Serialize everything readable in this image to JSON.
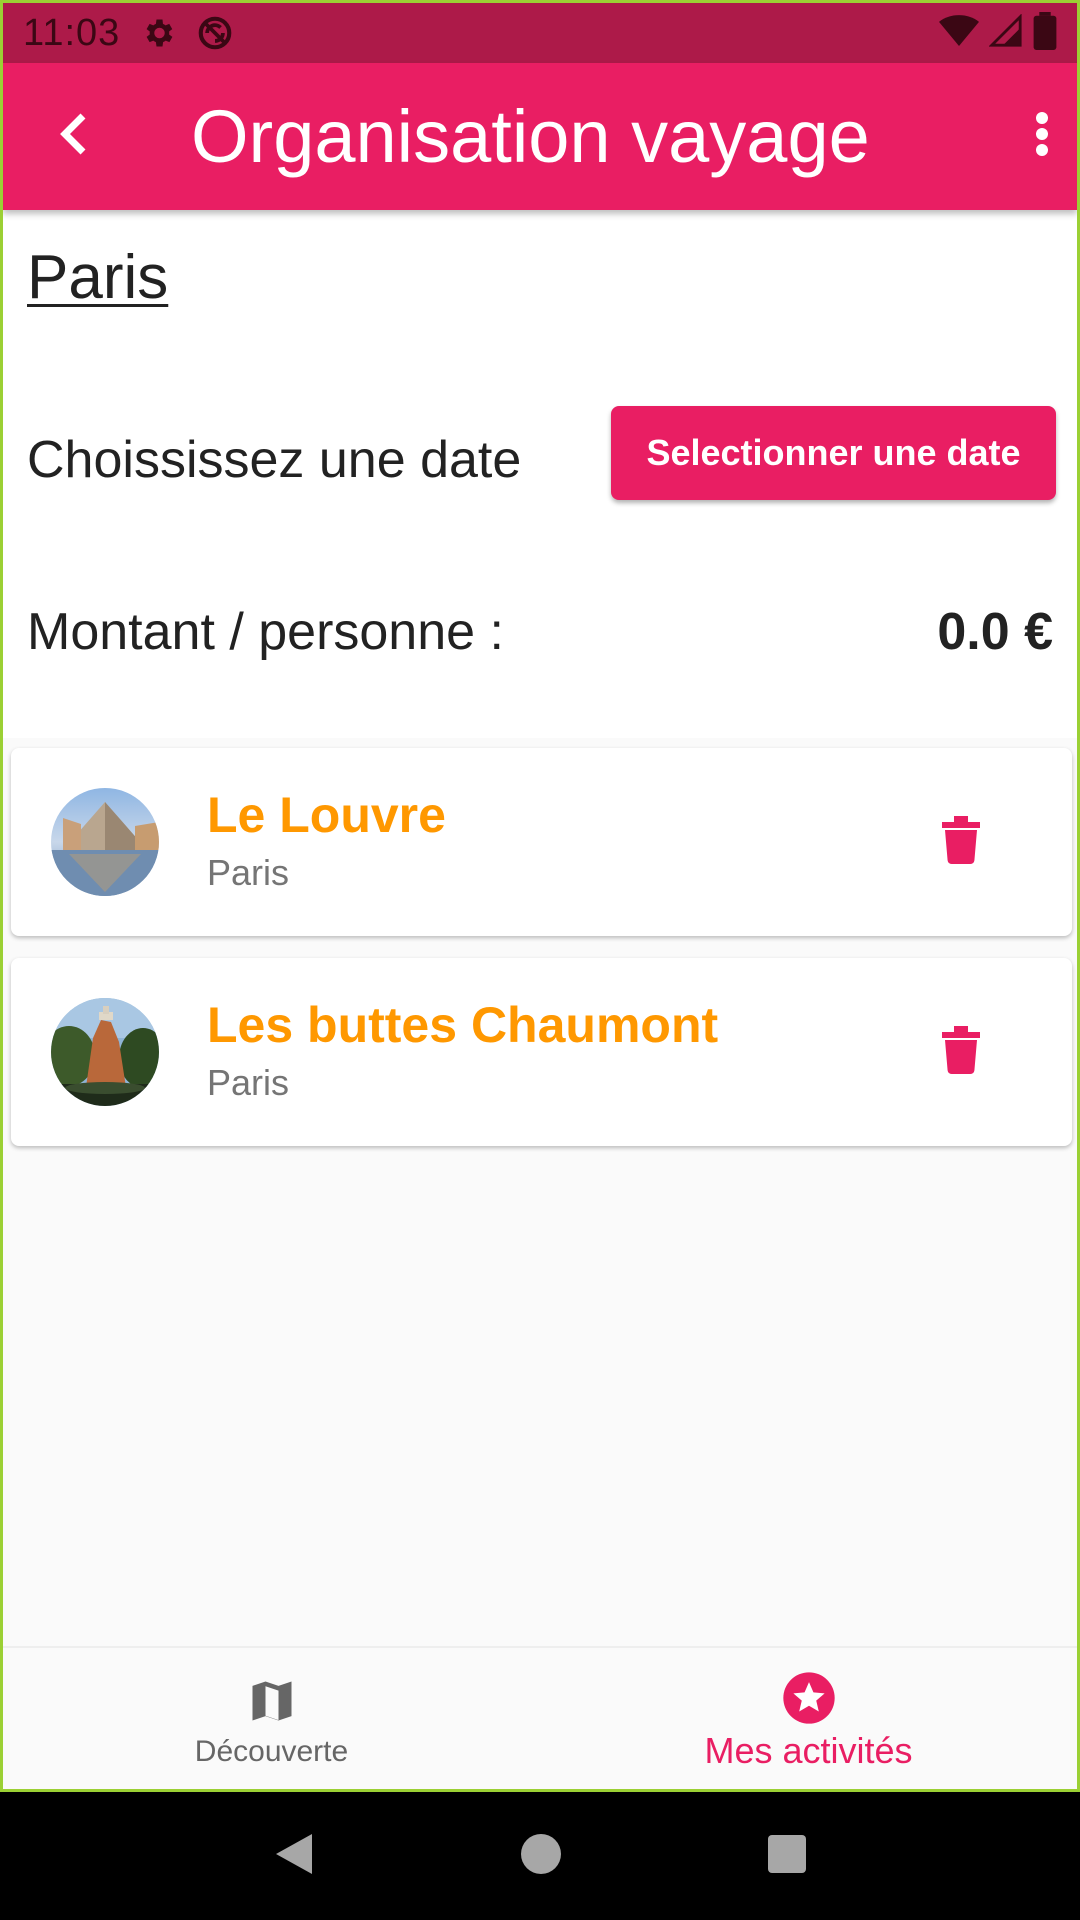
{
  "status_bar": {
    "time": "11:03",
    "icons": [
      "gear-icon",
      "no-sync-icon",
      "wifi-icon",
      "signal-icon",
      "battery-icon"
    ]
  },
  "app_bar": {
    "title": "Organisation vayage",
    "back_icon": "chevron-left-icon",
    "menu_icon": "more-vert-icon"
  },
  "header": {
    "city": "Paris",
    "date_label": "Choississez une date",
    "date_button": "Selectionner une date",
    "amount_label": "Montant / personne :",
    "amount_value": "0.0 €"
  },
  "activities": [
    {
      "title": "Le Louvre",
      "subtitle": "Paris",
      "image": "louvre-pyramid-thumbnail",
      "action_icon": "trash-icon"
    },
    {
      "title": "Les buttes Chaumont",
      "subtitle": "Paris",
      "image": "buttes-chaumont-thumbnail",
      "action_icon": "trash-icon"
    }
  ],
  "bottom_nav": {
    "items": [
      {
        "label": "Découverte",
        "icon": "map-icon",
        "active": false
      },
      {
        "label": "Mes activités",
        "icon": "star-circle-icon",
        "active": true
      }
    ]
  },
  "colors": {
    "primary": "#e91e63",
    "primary_dark": "#ad1a49",
    "accent": "#ff9800",
    "text_secondary": "#757575"
  }
}
